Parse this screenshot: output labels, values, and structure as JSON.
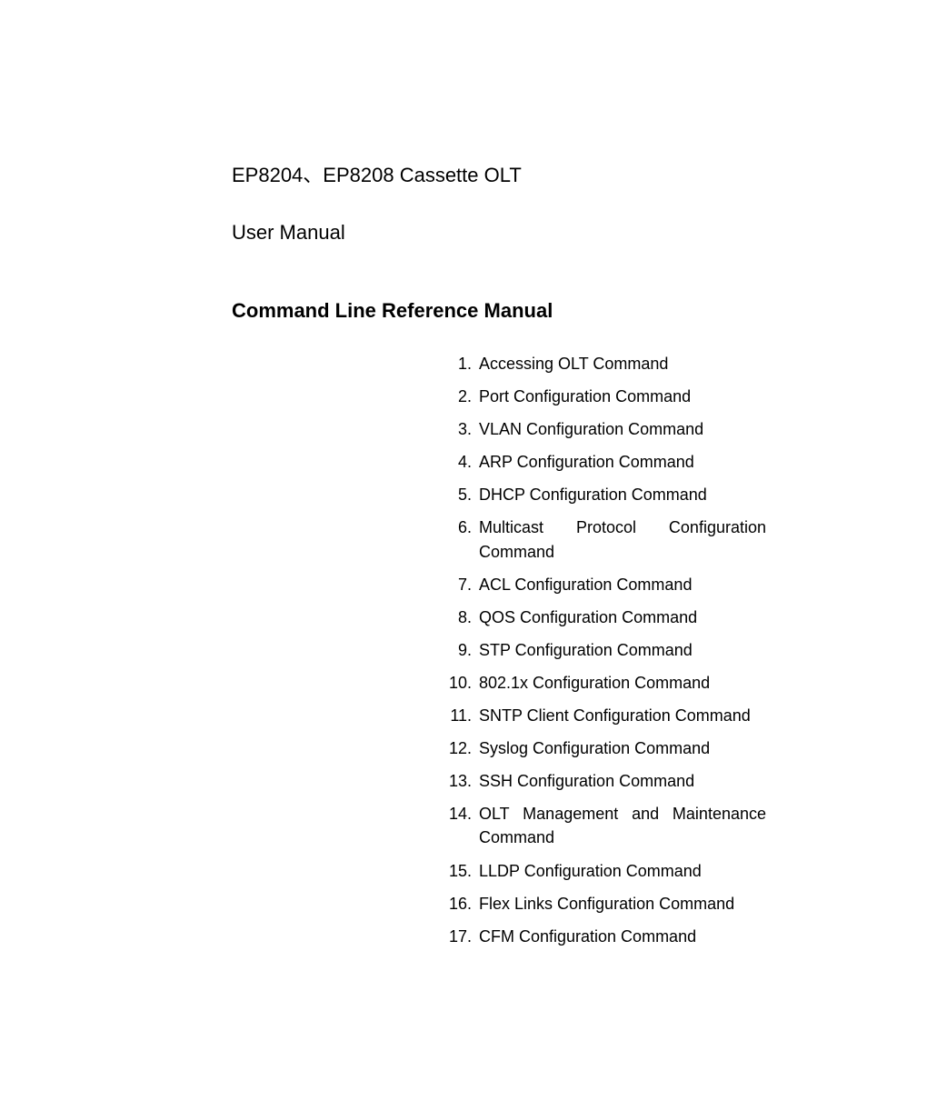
{
  "title_line_1": "EP8204、EP8208  Cassette OLT",
  "title_line_2": "User Manual",
  "section_heading": "Command Line Reference Manual",
  "toc": [
    {
      "num": "1.",
      "text": "Accessing OLT Command"
    },
    {
      "num": "2.",
      "text": "Port Configuration Command"
    },
    {
      "num": "3.",
      "text": "VLAN Configuration Command"
    },
    {
      "num": "4.",
      "text": "ARP Configuration Command"
    },
    {
      "num": "5.",
      "text": "DHCP Configuration Command"
    },
    {
      "num": "6.",
      "text": "Multicast Protocol Configuration Command"
    },
    {
      "num": "7.",
      "text": "ACL Configuration Command"
    },
    {
      "num": "8.",
      "text": "QOS Configuration Command"
    },
    {
      "num": "9.",
      "text": "STP Configuration Command"
    },
    {
      "num": "10.",
      "text": "802.1x Configuration Command"
    },
    {
      "num": "11.",
      "text": "SNTP Client Configuration Command"
    },
    {
      "num": "12.",
      "text": "Syslog Configuration Command"
    },
    {
      "num": "13.",
      "text": "SSH Configuration Command"
    },
    {
      "num": "14.",
      "text": "OLT Management and Maintenance Command"
    },
    {
      "num": "15.",
      "text": "LLDP Configuration Command"
    },
    {
      "num": "16.",
      "text": "Flex Links Configuration Command"
    },
    {
      "num": "17.",
      "text": "CFM Configuration Command"
    }
  ]
}
